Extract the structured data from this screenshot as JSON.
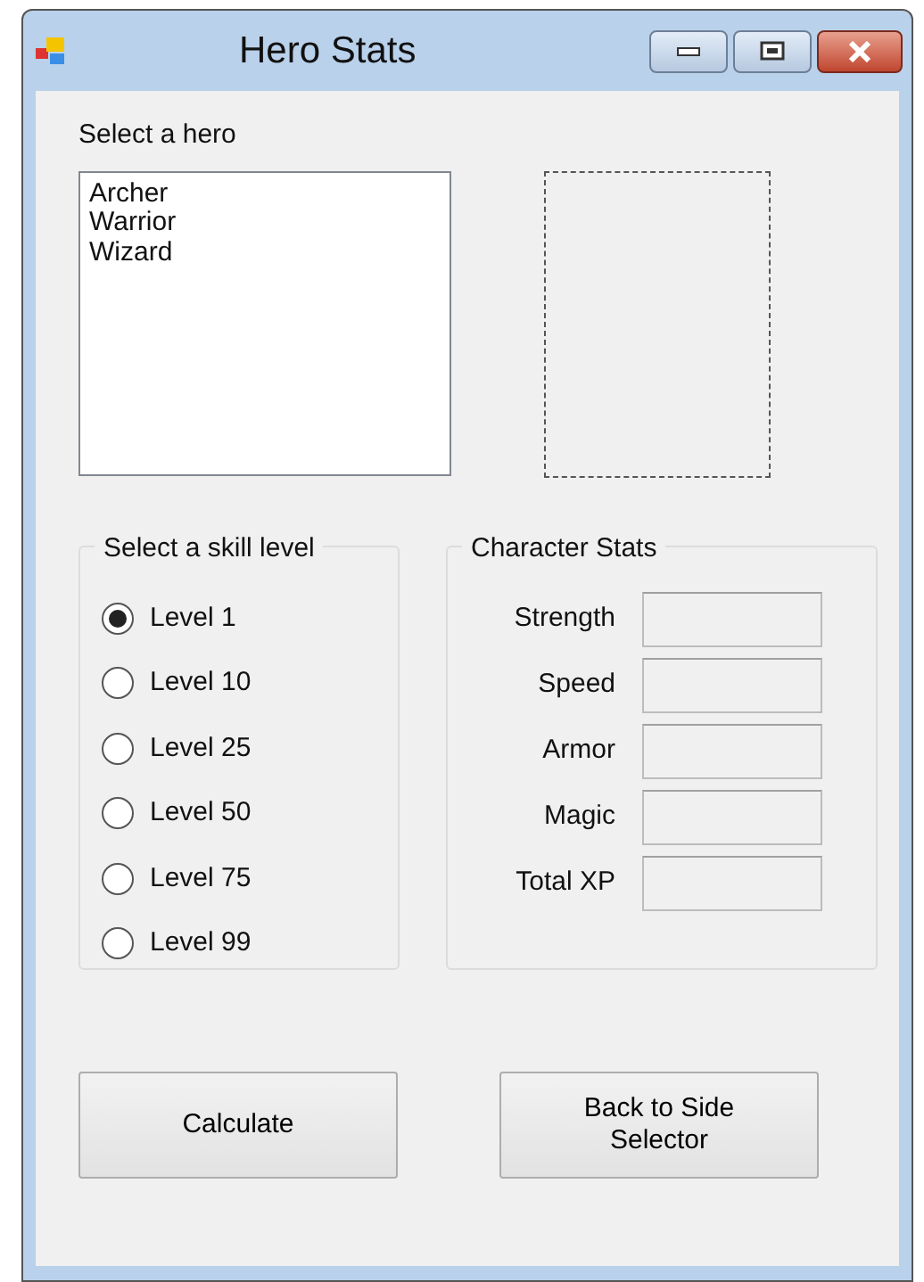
{
  "window": {
    "title": "Hero Stats"
  },
  "hero_list": {
    "label": "Select a hero",
    "items": [
      {
        "text": "Archer",
        "selected": false
      },
      {
        "text": "Warrior",
        "selected": false
      },
      {
        "text": "Wizard",
        "selected": false
      }
    ]
  },
  "skill_group": {
    "title": "Select a skill level",
    "options": [
      {
        "label": "Level 1",
        "selected": true
      },
      {
        "label": "Level 10",
        "selected": false
      },
      {
        "label": "Level 25",
        "selected": false
      },
      {
        "label": "Level 50",
        "selected": false
      },
      {
        "label": "Level 75",
        "selected": false
      },
      {
        "label": "Level 99",
        "selected": false
      }
    ]
  },
  "stats_group": {
    "title": "Character Stats",
    "fields": [
      {
        "label": "Strength"
      },
      {
        "label": "Speed"
      },
      {
        "label": "Armor"
      },
      {
        "label": "Magic"
      },
      {
        "label": "Total XP"
      }
    ]
  },
  "buttons": [
    {
      "label": "Calculate"
    },
    {
      "label": "Back to Side Selector"
    }
  ]
}
